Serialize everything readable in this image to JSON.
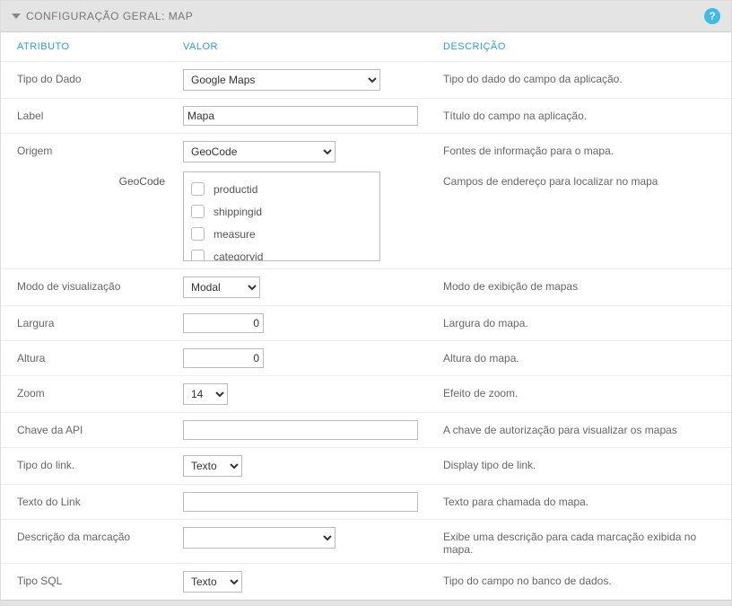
{
  "panel": {
    "title": "CONFIGURAÇÃO GERAL: MAP"
  },
  "columns": {
    "attr": "ATRIBUTO",
    "val": "VALOR",
    "desc": "DESCRIÇÃO"
  },
  "rows": {
    "tipo_dado": {
      "label": "Tipo do Dado",
      "desc": "Tipo do dado do campo da aplicação."
    },
    "label": {
      "label": "Label",
      "value": "Mapa",
      "desc": "Título do campo na aplicação."
    },
    "origem": {
      "label": "Origem",
      "desc": "Fontes de informação para o mapa."
    },
    "geocode": {
      "label": "GeoCode",
      "desc": "Campos de endereço para localizar no mapa"
    },
    "modo": {
      "label": "Modo de visualização",
      "desc": "Modo de exibição de mapas"
    },
    "largura": {
      "label": "Largura",
      "value": "0",
      "desc": "Largura do mapa."
    },
    "altura": {
      "label": "Altura",
      "value": "0",
      "desc": "Altura do mapa."
    },
    "zoom": {
      "label": "Zoom",
      "desc": "Efeito de zoom."
    },
    "apikey": {
      "label": "Chave da API",
      "value": "",
      "desc": "A chave de autorização para visualizar os mapas"
    },
    "tipo_link": {
      "label": "Tipo do link.",
      "desc": "Display tipo de link."
    },
    "texto_link": {
      "label": "Texto do Link",
      "value": "",
      "desc": "Texto para chamada do mapa."
    },
    "desc_marc": {
      "label": "Descrição da marcação",
      "desc": "Exibe uma descrição para cada marcação exibida no mapa."
    },
    "tipo_sql": {
      "label": "Tipo SQL",
      "desc": "Tipo do campo no banco de dados."
    }
  },
  "selects": {
    "tipo_dado": {
      "selected": "Google Maps"
    },
    "origem": {
      "selected": "GeoCode"
    },
    "modo": {
      "selected": "Modal"
    },
    "zoom": {
      "selected": "14"
    },
    "tipo_link": {
      "selected": "Texto"
    },
    "desc_marc": {
      "selected": ""
    },
    "tipo_sql": {
      "selected": "Texto"
    }
  },
  "checklist": {
    "items": [
      "productid",
      "shippingid",
      "measure",
      "categoryid"
    ]
  }
}
